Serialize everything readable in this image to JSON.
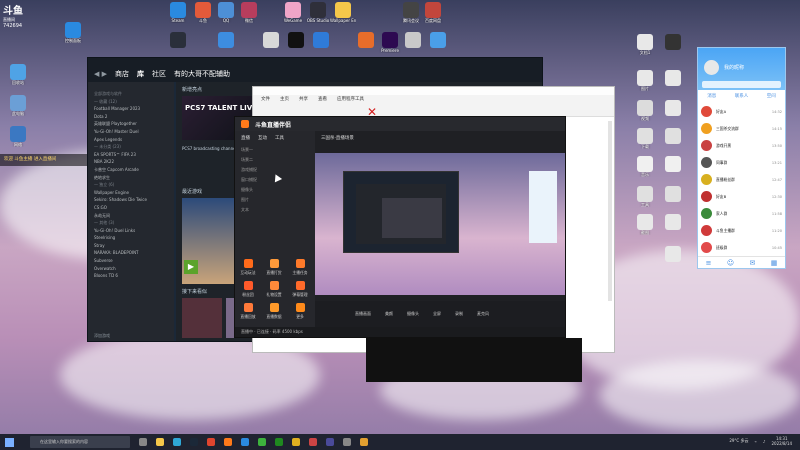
{
  "overlay": {
    "brand": "斗鱼",
    "sub": "直播间",
    "room": "742694"
  },
  "ticker": "欢迎 斗鱼主播 进入直播间",
  "steam": {
    "nav": [
      "商店",
      "库",
      "社区",
      "有的大哥不配辅助"
    ],
    "featured_label": "新增亮点",
    "featured_title": "PCS7 TALENT LIVE",
    "featured_desc": "PCS7 broadcasting channel and more",
    "recent_label": "最近游戏",
    "friends_label": "接下来看似",
    "library_rows": [
      "全部游戏与软件",
      "— 收藏 (12)",
      "Football Manager 2023",
      "Dota 2",
      "英雄联盟 Playtogether",
      "Yu-Gi-Oh! Master Duel",
      "Apex Legends",
      "— 未分类 (23)",
      "EA SPORTS™ FIFA 23",
      "NBA 2K22",
      "卡普空 Capcom Arcade",
      "绝地求生",
      "— 独立 (6)",
      "Wallpaper Engine",
      "Sekiro: Shadows Die Twice",
      "CS:GO",
      "永劫无间",
      "— 其他 (3)",
      "Yu-Gi-Oh! Duel Links",
      "Steelrising",
      "Stray",
      "NARAKA: BLADEPOINT",
      "Subverse",
      "Overwatch",
      "Bloons TD 6"
    ],
    "footer": "添加游戏"
  },
  "explorer": {
    "tabs": [
      "文件",
      "主页",
      "共享",
      "查看",
      "应用程序工具"
    ]
  },
  "stream": {
    "title": "斗鱼直播伴侣",
    "tabs": [
      "直播",
      "互动",
      "工具"
    ],
    "scene_label": "三国杀·直播场景",
    "side_rows": [
      "场景一",
      "场景二",
      "游戏捕捉",
      "窗口捕捉",
      "摄像头",
      "图片",
      "文本"
    ],
    "tiles": [
      "互动玩法",
      "直播打赏",
      "主播任务",
      "粉丝团",
      "礼物设置",
      "弹幕管理",
      "直播回放",
      "直播数据",
      "更多"
    ],
    "tools": [
      "直播画面",
      "美颜",
      "摄像头",
      "全屏",
      "录制",
      "麦克风"
    ],
    "status": "直播中 · 已连接 · 码率 4500 kbps"
  },
  "qq": {
    "nickname": "我的昵称",
    "tabs": [
      "消息",
      "联系人",
      "空间"
    ],
    "chats": [
      {
        "name": "好友A",
        "time": "14:32"
      },
      {
        "name": "三国杀交流群",
        "time": "14:15"
      },
      {
        "name": "游戏开黑",
        "time": "13:50"
      },
      {
        "name": "同事群",
        "time": "13:21"
      },
      {
        "name": "直播粉丝群",
        "time": "12:47"
      },
      {
        "name": "好友B",
        "time": "12:30"
      },
      {
        "name": "家人群",
        "time": "11:58"
      },
      {
        "name": "斗鱼主播群",
        "time": "11:20"
      },
      {
        "name": "班级群",
        "time": "10:45"
      },
      {
        "name": "好友C",
        "time": "09:12"
      }
    ]
  },
  "taskbar": {
    "search_placeholder": "在这里输入你要搜索的内容",
    "weather": "29°C 多云",
    "time": "14:31",
    "date": "2022/8/14"
  },
  "desktop_icons": [
    "回收站",
    "此电脑",
    "网络",
    "控制面板",
    "Steam",
    "斗鱼",
    "QQ",
    "微信",
    "WeGame",
    "OBS Studio",
    "Wallpaper Engine",
    "腾讯会议",
    "百度网盘",
    "Premiere",
    "Photoshop",
    "Chrome"
  ],
  "right_icons": [
    "文档1",
    "图片",
    "视频",
    "下载",
    "音乐",
    "工具",
    "截图",
    "素材",
    "备份"
  ]
}
